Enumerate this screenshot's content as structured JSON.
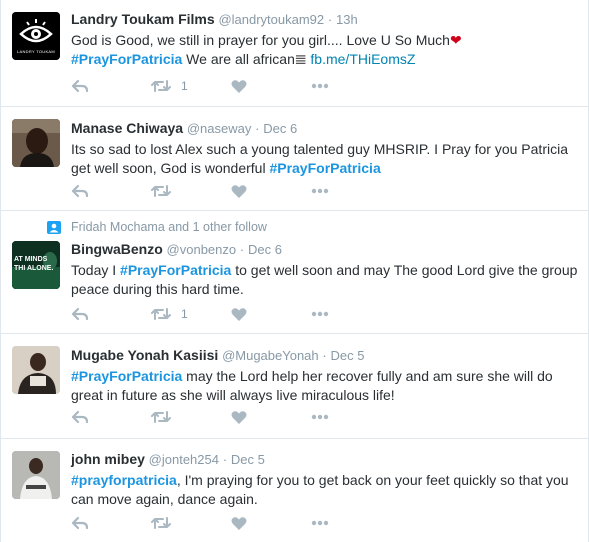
{
  "tweets": [
    {
      "name": "Landry Toukam Films",
      "handle": "@landrytoukam92",
      "sep": "·",
      "time": "13h",
      "text1": "God is Good, we still in prayer for you girl.... Love U So Much",
      "emoji": "❤",
      "hashtag": "#PrayForPatricia",
      "text2": " We are all african",
      "box": "𝌆",
      "link": "fb.me/THiEomsZ",
      "retweets": "1",
      "avatar_caption": "LANDRY TOUKAM"
    },
    {
      "name": "Manase Chiwaya",
      "handle": "@naseway",
      "sep": "·",
      "time": "Dec 6",
      "text1": "Its so sad to lost Alex such a young talented guy MHSRIP. I Pray for you Patricia get well soon, God is wonderful ",
      "hashtag": "#PrayForPatricia"
    },
    {
      "context": "Fridah Mochama and 1 other follow",
      "name": "BingwaBenzo",
      "handle": "@vonbenzo",
      "sep": "·",
      "time": "Dec 6",
      "text1": "Today I ",
      "hashtag": "#PrayForPatricia",
      "text2": " to get well soon and may The good Lord give the group peace during this hard time.",
      "retweets": "1",
      "avatar_caption": "AT MINDS THI ALONE."
    },
    {
      "name": "Mugabe Yonah Kasiisi",
      "handle": "@MugabeYonah",
      "sep": "·",
      "time": "Dec 5",
      "hashtag": "#PrayForPatricia",
      "text2": " may the Lord help her recover fully and am sure she will do great in future as she will always live miraculous life!"
    },
    {
      "name": "john mibey",
      "handle": "@jonteh254",
      "sep": "·",
      "time": "Dec 5",
      "hashtag": "#prayforpatricia",
      "text2": ", I'm praying for you  to get back on your feet quickly so that you can move again, dance again."
    }
  ],
  "colors": {
    "link": "#1b95e0",
    "meta": "#8899a6",
    "border": "#e1e8ed"
  },
  "icons": [
    "reply-icon",
    "retweet-icon",
    "like-icon",
    "more-icon",
    "follow-context-icon"
  ]
}
